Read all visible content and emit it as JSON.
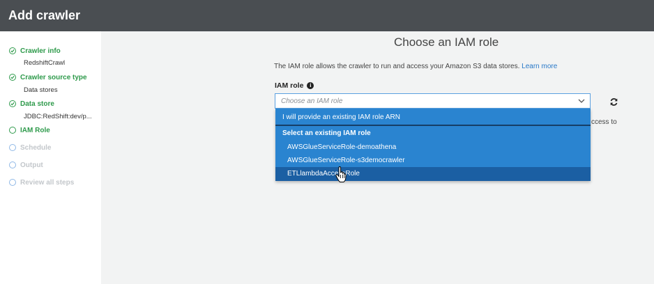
{
  "header": {
    "title": "Add crawler"
  },
  "sidebar": {
    "steps": [
      {
        "label": "Crawler info",
        "sub": "RedshiftCrawl",
        "state": "done"
      },
      {
        "label": "Crawler source type",
        "sub": "Data stores",
        "state": "done"
      },
      {
        "label": "Data store",
        "sub": "JDBC:RedShift:dev/p...",
        "state": "done"
      },
      {
        "label": "IAM Role",
        "state": "current"
      },
      {
        "label": "Schedule",
        "state": "pending"
      },
      {
        "label": "Output",
        "state": "pending"
      },
      {
        "label": "Review all steps",
        "state": "pending"
      }
    ]
  },
  "main": {
    "title": "Choose an IAM role",
    "description": "The IAM role allows the crawler to run and access your Amazon S3 data stores.",
    "learn_more": "Learn more",
    "field_label": "IAM role",
    "select_placeholder": "Choose an IAM role",
    "behind_text_1": "ccess to",
    "behind_text_2": "",
    "dropdown": {
      "provide_option": "I will provide an existing IAM role ARN",
      "group_label": "Select an existing IAM role",
      "options": [
        "AWSGlueServiceRole-demoathena",
        "AWSGlueServiceRole-s3democrawler",
        "ETLlambdaAccessRole"
      ],
      "highlighted_index": 2
    }
  },
  "colors": {
    "header_bg": "#4a4e52",
    "done_green": "#2e9a4b",
    "dropdown_blue": "#2a84d0",
    "dropdown_highlight": "#1b5fa3",
    "link": "#2878c8"
  },
  "icons": [
    "check-circle-icon",
    "info-icon",
    "chevron-down-icon",
    "refresh-icon",
    "hand-cursor-icon"
  ]
}
